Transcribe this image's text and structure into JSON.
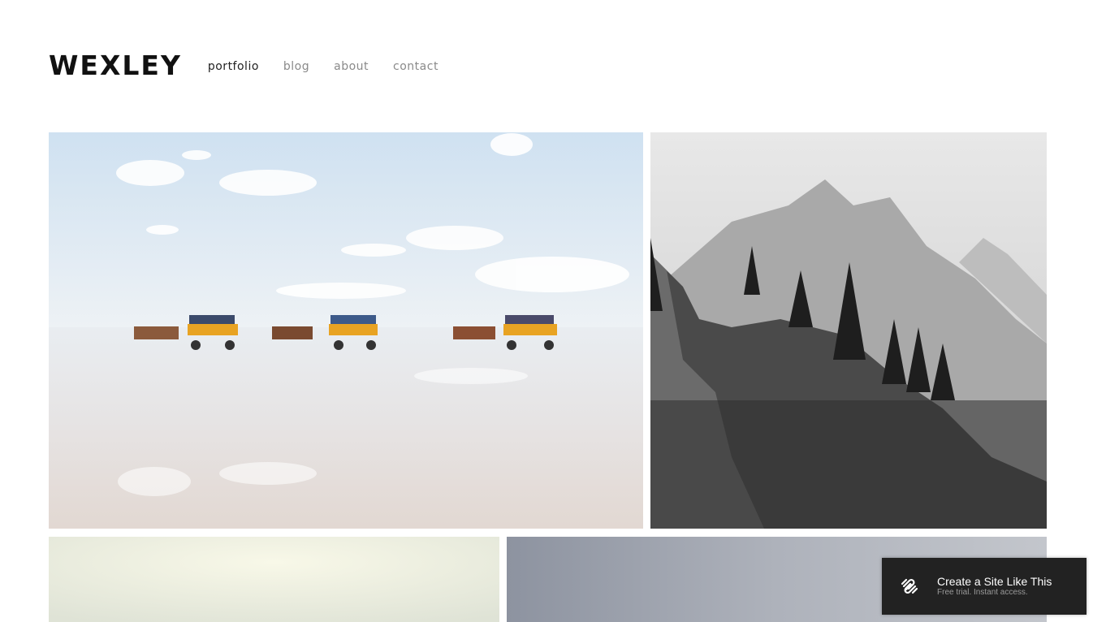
{
  "site": {
    "logo": "WEXLEY"
  },
  "nav": {
    "items": [
      {
        "label": "portfolio",
        "active": true
      },
      {
        "label": "blog",
        "active": false
      },
      {
        "label": "about",
        "active": false
      },
      {
        "label": "contact",
        "active": false
      }
    ]
  },
  "gallery": {
    "images": [
      {
        "subject": "horse-drawn wagons on tidal flat"
      },
      {
        "subject": "black and white mountain cliff with pine trees"
      },
      {
        "subject": "bright hazy landscape"
      },
      {
        "subject": "grey overcast sky"
      }
    ]
  },
  "promo": {
    "title": "Create a Site Like This",
    "subtitle": "Free trial. Instant access.",
    "icon": "squarespace-logo-icon"
  },
  "colors": {
    "badge_bg": "#222222",
    "text_dark": "#111111",
    "nav_muted": "#8a8a8a"
  }
}
